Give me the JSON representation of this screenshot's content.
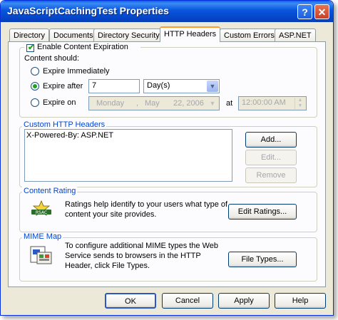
{
  "window": {
    "title": "JavaScriptCachingTest Properties",
    "help_glyph": "?",
    "close_glyph": "✕"
  },
  "tabs": [
    {
      "label": "Directory"
    },
    {
      "label": "Documents"
    },
    {
      "label": "Directory Security"
    },
    {
      "label": "HTTP Headers",
      "active": true
    },
    {
      "label": "Custom Errors"
    },
    {
      "label": "ASP.NET"
    }
  ],
  "content_expiration": {
    "enable_label": "Enable Content Expiration",
    "enabled": true,
    "content_should_label": "Content should:",
    "expire_immediately_label": "Expire Immediately",
    "expire_after_label": "Expire after",
    "expire_after_value": "7",
    "unit_value": "Day(s)",
    "expire_on_label": "Expire on",
    "selected_option": "expire_after",
    "date": {
      "day": "Monday",
      "sep1": ",",
      "month": "May",
      "daynum": "22, 2006"
    },
    "at_label": "at",
    "time_value": "12:00:00 AM"
  },
  "custom_headers": {
    "group_label": "Custom HTTP Headers",
    "items": [
      "X-Powered-By: ASP.NET"
    ],
    "add_label": "Add...",
    "edit_label": "Edit...",
    "remove_label": "Remove"
  },
  "content_rating": {
    "group_label": "Content Rating",
    "description": [
      "Ratings help identify to your users what type of",
      "content your site provides."
    ],
    "button_label": "Edit Ratings..."
  },
  "mime_map": {
    "group_label": "MIME Map",
    "description": [
      "To configure additional MIME types the Web",
      "Service sends to browsers in the HTTP",
      "Header, click File Types."
    ],
    "button_label": "File Types..."
  },
  "footer": {
    "ok_label": "OK",
    "cancel_label": "Cancel",
    "apply_label": "Apply",
    "help_label": "Help"
  },
  "colors": {
    "titlebar": "#0855dd",
    "group_label": "#0046d5",
    "active_tab_accent": "#ff9b2f",
    "dialog_bg": "#ece9d8"
  }
}
